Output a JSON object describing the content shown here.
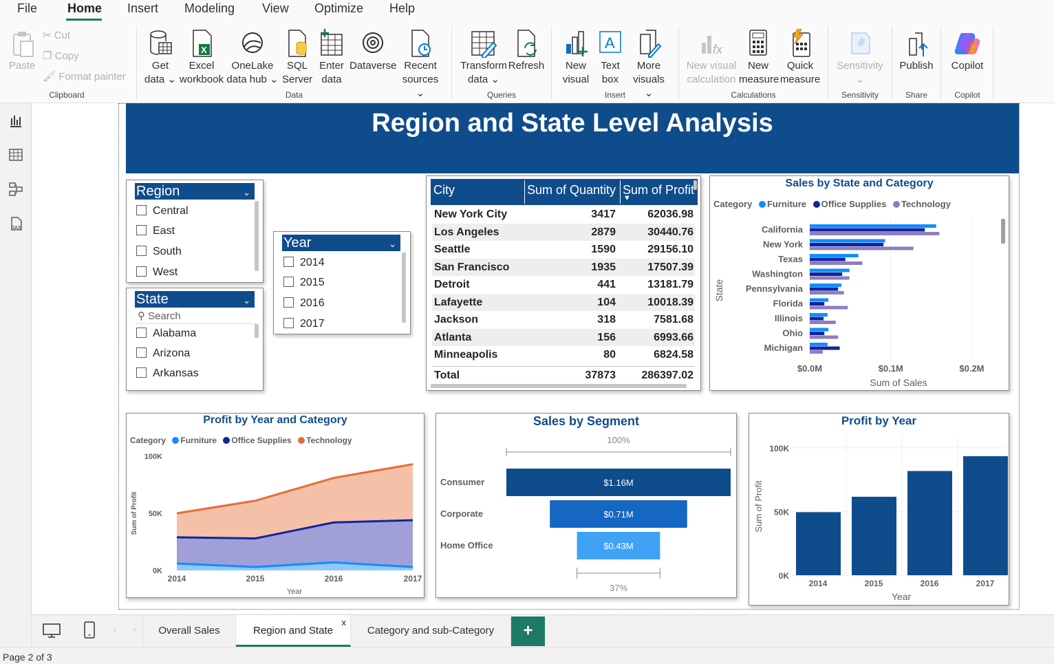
{
  "menu": {
    "file": "File",
    "home": "Home",
    "insert": "Insert",
    "modeling": "Modeling",
    "view": "View",
    "optimize": "Optimize",
    "help": "Help"
  },
  "ribbon": {
    "paste": "Paste",
    "cut": "Cut",
    "copy": "Copy",
    "format_painter": "Format painter",
    "get_data_1": "Get",
    "get_data_2": "data",
    "excel_1": "Excel",
    "excel_2": "workbook",
    "onelake_1": "OneLake",
    "onelake_2": "data hub",
    "sql_1": "SQL",
    "sql_2": "Server",
    "enter_1": "Enter",
    "enter_2": "data",
    "dataverse": "Dataverse",
    "recent_1": "Recent",
    "recent_2": "sources",
    "transform_1": "Transform",
    "transform_2": "data",
    "refresh": "Refresh",
    "newvisual_1": "New",
    "newvisual_2": "visual",
    "textbox_1": "Text",
    "textbox_2": "box",
    "more_1": "More",
    "more_2": "visuals",
    "newcalc_1": "New visual",
    "newcalc_2": "calculation",
    "newmeasure_1": "New",
    "newmeasure_2": "measure",
    "quick_1": "Quick",
    "quick_2": "measure",
    "sensitivity": "Sensitivity",
    "publish": "Publish",
    "copilot": "Copilot",
    "groups": {
      "clipboard": "Clipboard",
      "data": "Data",
      "queries": "Queries",
      "insert": "Insert",
      "calculations": "Calculations",
      "sensitivity": "Sensitivity",
      "share": "Share",
      "copilot": "Copilot"
    }
  },
  "report": {
    "title": "Region and State Level Analysis"
  },
  "region_slicer": {
    "header": "Region",
    "items": [
      "Central",
      "East",
      "South",
      "West"
    ]
  },
  "state_slicer": {
    "header": "State",
    "search_placeholder": "Search",
    "items": [
      "Alabama",
      "Arizona",
      "Arkansas"
    ]
  },
  "year_slicer": {
    "header": "Year",
    "items": [
      "2014",
      "2015",
      "2016",
      "2017"
    ]
  },
  "city_table": {
    "columns": [
      "City",
      "Sum of Quantity",
      "Sum of Profit"
    ],
    "rows": [
      [
        "New York City",
        "3417",
        "62036.98"
      ],
      [
        "Los Angeles",
        "2879",
        "30440.76"
      ],
      [
        "Seattle",
        "1590",
        "29156.10"
      ],
      [
        "San Francisco",
        "1935",
        "17507.39"
      ],
      [
        "Detroit",
        "441",
        "13181.79"
      ],
      [
        "Lafayette",
        "104",
        "10018.39"
      ],
      [
        "Jackson",
        "318",
        "7581.68"
      ],
      [
        "Atlanta",
        "156",
        "6993.66"
      ],
      [
        "Minneapolis",
        "80",
        "6824.58"
      ]
    ],
    "total": [
      "Total",
      "37873",
      "286397.02"
    ]
  },
  "colors": {
    "furniture": "#118dff",
    "office_supplies": "#12239e",
    "technology_bar": "#8c7fc0",
    "technology_area": "#e66c37",
    "navy": "#0f4c8c",
    "mid_blue": "#1467c2",
    "light_blue": "#3ea3f5"
  },
  "chart_data": [
    {
      "type": "bar",
      "orientation": "horizontal",
      "title": "Sales by State and Category",
      "legend_title": "Category",
      "ylabel": "State",
      "xlabel": "Sum of Sales",
      "x_ticks": [
        "$0.0M",
        "$0.1M",
        "$0.2M"
      ],
      "xlim": [
        0,
        0.22
      ],
      "categories": [
        "California",
        "New York",
        "Texas",
        "Washington",
        "Pennsylvania",
        "Florida",
        "Illinois",
        "Ohio",
        "Michigan"
      ],
      "series": [
        {
          "name": "Furniture",
          "values": [
            0.156,
            0.093,
            0.06,
            0.049,
            0.039,
            0.023,
            0.022,
            0.023,
            0.022
          ]
        },
        {
          "name": "Office Supplies",
          "values": [
            0.142,
            0.091,
            0.044,
            0.04,
            0.035,
            0.018,
            0.017,
            0.018,
            0.037
          ]
        },
        {
          "name": "Technology",
          "values": [
            0.16,
            0.128,
            0.065,
            0.049,
            0.042,
            0.047,
            0.032,
            0.035,
            0.016
          ]
        }
      ]
    },
    {
      "type": "area",
      "stacked": true,
      "title": "Profit by Year and Category",
      "legend_title": "Category",
      "xlabel": "Year",
      "ylabel": "Sum of Profit",
      "y_ticks": [
        "0K",
        "50K",
        "100K"
      ],
      "ylim": [
        0,
        100000
      ],
      "x": [
        "2014",
        "2015",
        "2016",
        "2017"
      ],
      "series": [
        {
          "name": "Furniture",
          "values": [
            6000,
            3000,
            7000,
            3000
          ]
        },
        {
          "name": "Office Supplies",
          "values": [
            23000,
            25000,
            35000,
            41000
          ]
        },
        {
          "name": "Technology",
          "values": [
            21000,
            33000,
            39000,
            49000
          ]
        }
      ]
    },
    {
      "type": "bar",
      "variant": "funnel",
      "title": "Sales by Segment",
      "categories": [
        "Consumer",
        "Corporate",
        "Home Office"
      ],
      "values": [
        1.16,
        0.71,
        0.43
      ],
      "labels": [
        "$1.16M",
        "$0.71M",
        "$0.43M"
      ],
      "top_pct": "100%",
      "bottom_pct": "37%"
    },
    {
      "type": "bar",
      "title": "Profit by Year",
      "xlabel": "Year",
      "ylabel": "Sum of Profit",
      "y_ticks": [
        "0K",
        "50K",
        "100K"
      ],
      "ylim": [
        0,
        108000
      ],
      "categories": [
        "2014",
        "2015",
        "2016",
        "2017"
      ],
      "values": [
        49500,
        61600,
        81800,
        93400
      ]
    }
  ],
  "tabs": {
    "items": [
      "Overall Sales",
      "Region and State",
      "Category and sub-Category"
    ],
    "close": "x",
    "add": "+"
  },
  "status": {
    "page": "Page 2 of 3"
  }
}
